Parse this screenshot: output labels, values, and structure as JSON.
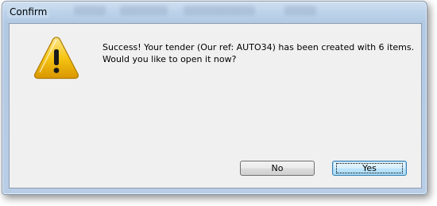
{
  "window": {
    "title": "Confirm"
  },
  "dialog": {
    "icon": "warning-icon",
    "message_line1": "Success! Your tender (Our ref: AUTO34) has been created with 6 items.",
    "message_line2": "Would you like to open it now?"
  },
  "buttons": {
    "no_label": "No",
    "yes_label": "Yes"
  },
  "colors": {
    "frame": "#b9cee6",
    "client_bg": "#f0f0f0",
    "icon_yellow": "#f2c200",
    "default_button_border": "#3c7fb1"
  }
}
